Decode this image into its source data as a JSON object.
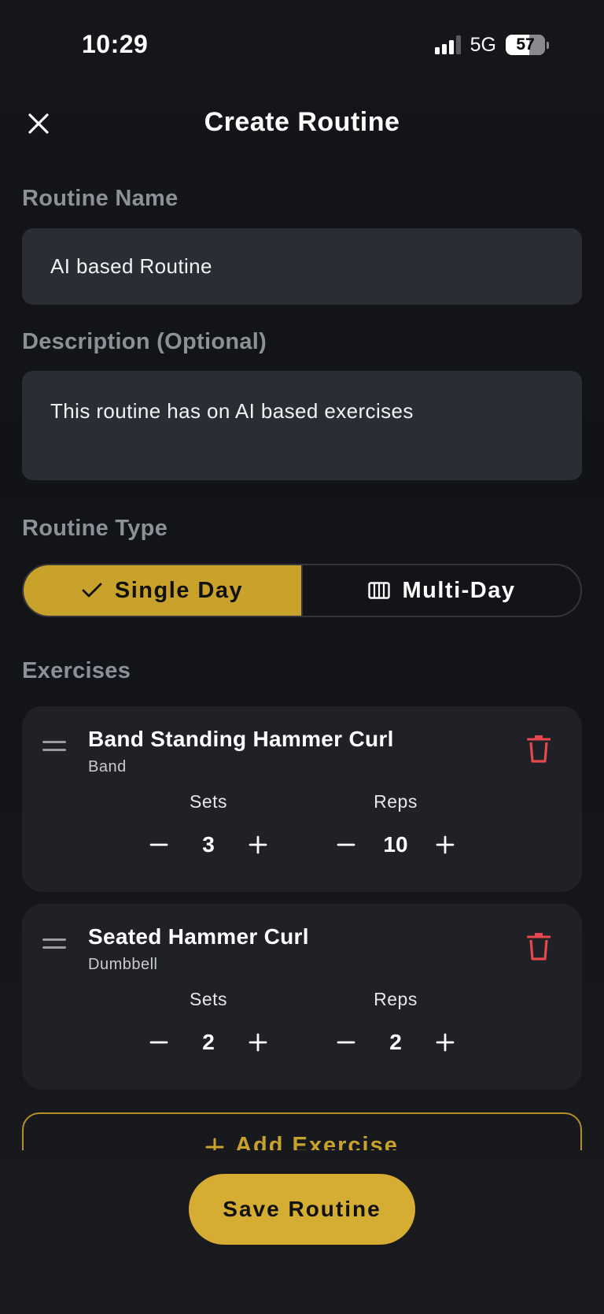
{
  "status_bar": {
    "time": "10:29",
    "network": "5G",
    "battery": "57"
  },
  "header": {
    "title": "Create Routine",
    "close_icon": "close-icon"
  },
  "form": {
    "name_label": "Routine Name",
    "name_value": "AI based Routine",
    "description_label": "Description (Optional)",
    "description_value": "This routine has on AI based exercises",
    "type_label": "Routine Type",
    "type_options": [
      {
        "label": "Single Day",
        "icon": "check-icon",
        "selected": true
      },
      {
        "label": "Multi-Day",
        "icon": "calendar-columns-icon",
        "selected": false
      }
    ]
  },
  "exercises": {
    "label": "Exercises",
    "items": [
      {
        "name": "Band Standing Hammer Curl",
        "equipment": "Band",
        "sets_label": "Sets",
        "sets": "3",
        "reps_label": "Reps",
        "reps": "10"
      },
      {
        "name": "Seated Hammer Curl",
        "equipment": "Dumbbell",
        "sets_label": "Sets",
        "sets": "2",
        "reps_label": "Reps",
        "reps": "2"
      }
    ],
    "add_label": "Add Exercise"
  },
  "actions": {
    "save_label": "Save Routine"
  },
  "colors": {
    "accent": "#c9a22c",
    "delete": "#e5484d",
    "field_bg": "#2a2d34",
    "card_bg": "#1f2126"
  }
}
